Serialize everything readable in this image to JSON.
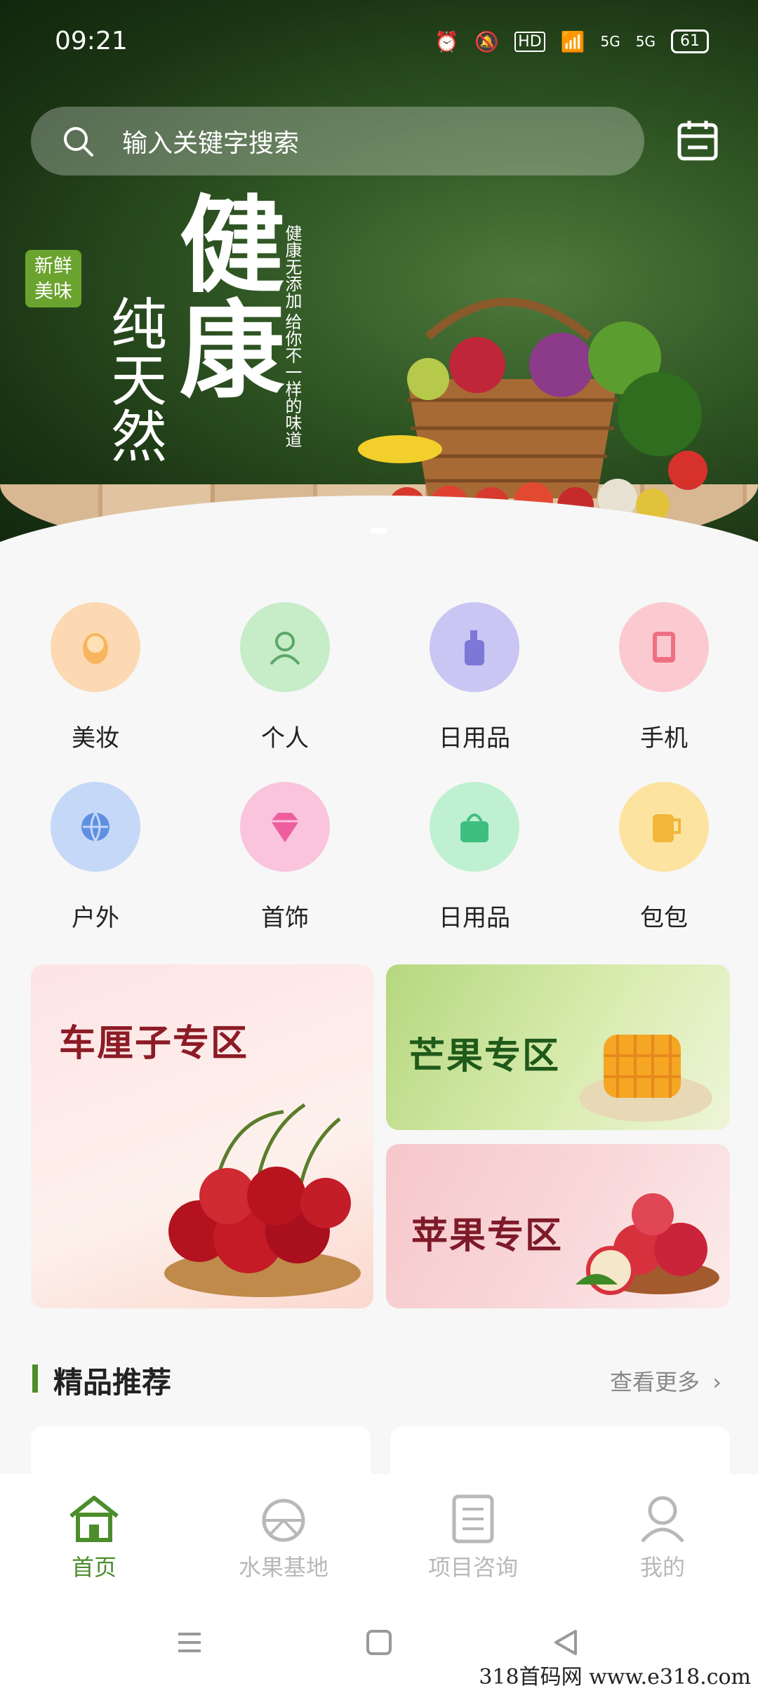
{
  "status": {
    "time": "09:21",
    "battery": "61",
    "network": "5G"
  },
  "search": {
    "placeholder": "输入关键字搜索"
  },
  "hero": {
    "badge_line1": "新鲜",
    "badge_line2": "美味",
    "title_big": "健康",
    "title_small": "纯天然",
    "subtitle_col1": "健康无添加",
    "subtitle_col2": "给你不一样的味道"
  },
  "categories": [
    {
      "label": "美妆",
      "icon": "beauty-icon",
      "color": "#fcd9b3"
    },
    {
      "label": "个人",
      "icon": "person-icon",
      "color": "#c6ecc8"
    },
    {
      "label": "日用品",
      "icon": "bottle-icon",
      "color": "#c9c6f3"
    },
    {
      "label": "手机",
      "icon": "phone-icon",
      "color": "#fbc9d0"
    },
    {
      "label": "户外",
      "icon": "globe-icon",
      "color": "#c5d8f7"
    },
    {
      "label": "首饰",
      "icon": "diamond-icon",
      "color": "#f9c4dc"
    },
    {
      "label": "日用品",
      "icon": "bag-icon",
      "color": "#bff0d2"
    },
    {
      "label": "包包",
      "icon": "cup-icon",
      "color": "#fde3a0"
    }
  ],
  "promos": {
    "cherry": "车厘子专区",
    "mango": "芒果专区",
    "apple": "苹果专区"
  },
  "section": {
    "title": "精品推荐",
    "more": "查看更多"
  },
  "tabs": [
    {
      "label": "首页",
      "icon": "home-icon",
      "active": true
    },
    {
      "label": "水果基地",
      "icon": "fruit-icon",
      "active": false
    },
    {
      "label": "项目咨询",
      "icon": "list-icon",
      "active": false
    },
    {
      "label": "我的",
      "icon": "user-icon",
      "active": false
    }
  ],
  "watermark": "318首码网 www.e318.com",
  "colors": {
    "accent": "#4c8d2c",
    "inactive": "#b8b8b8"
  }
}
